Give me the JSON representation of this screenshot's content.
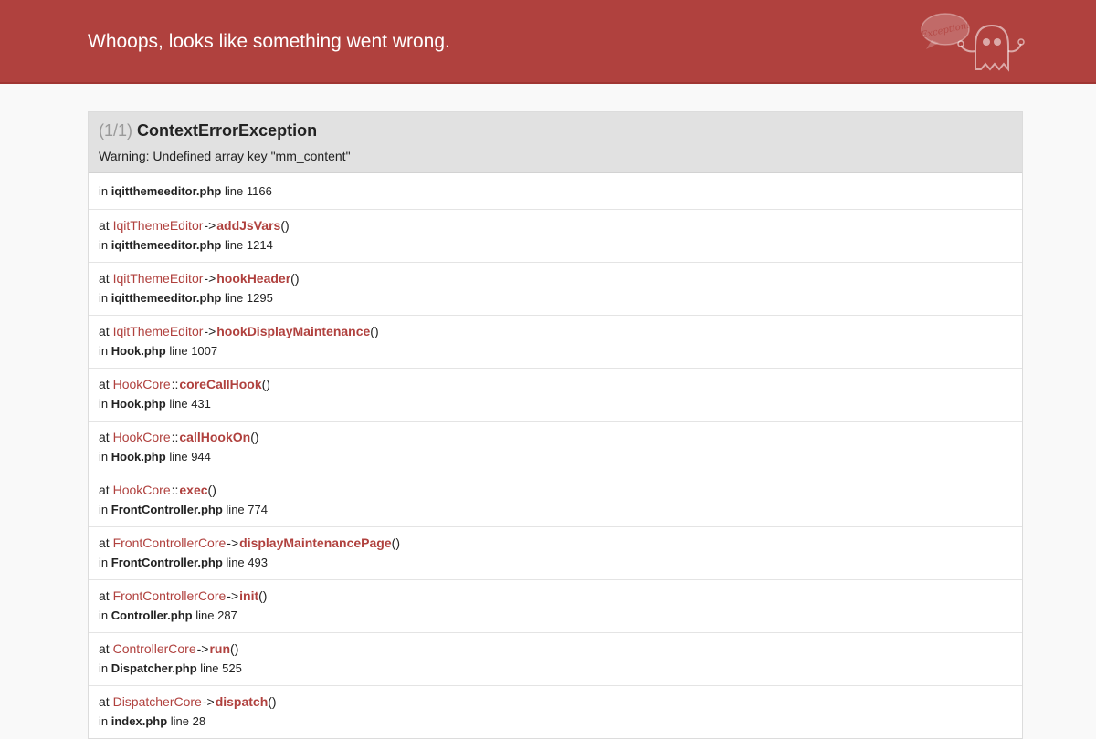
{
  "header": {
    "title": "Whoops, looks like something went wrong.",
    "logo_bubble": "Exception!"
  },
  "exception": {
    "count": "(1/1)",
    "name": "ContextErrorException",
    "message": "Warning: Undefined array key \"mm_content\""
  },
  "trace": [
    {
      "at": "",
      "cls": "",
      "op": "",
      "fn": "",
      "in": "in",
      "file": "iqitthemeeditor.php",
      "line_label": "line",
      "line": "1166"
    },
    {
      "at": "at",
      "cls": "IqitThemeEditor",
      "op": "->",
      "fn": "addJsVars",
      "parens": "()",
      "in": "in",
      "file": "iqitthemeeditor.php",
      "line_label": "line",
      "line": "1214"
    },
    {
      "at": "at",
      "cls": "IqitThemeEditor",
      "op": "->",
      "fn": "hookHeader",
      "parens": "()",
      "in": "in",
      "file": "iqitthemeeditor.php",
      "line_label": "line",
      "line": "1295"
    },
    {
      "at": "at",
      "cls": "IqitThemeEditor",
      "op": "->",
      "fn": "hookDisplayMaintenance",
      "parens": "()",
      "in": "in",
      "file": "Hook.php",
      "line_label": "line",
      "line": "1007"
    },
    {
      "at": "at",
      "cls": "HookCore",
      "op": "::",
      "fn": "coreCallHook",
      "parens": "()",
      "in": "in",
      "file": "Hook.php",
      "line_label": "line",
      "line": "431"
    },
    {
      "at": "at",
      "cls": "HookCore",
      "op": "::",
      "fn": "callHookOn",
      "parens": "()",
      "in": "in",
      "file": "Hook.php",
      "line_label": "line",
      "line": "944"
    },
    {
      "at": "at",
      "cls": "HookCore",
      "op": "::",
      "fn": "exec",
      "parens": "()",
      "in": "in",
      "file": "FrontController.php",
      "line_label": "line",
      "line": "774"
    },
    {
      "at": "at",
      "cls": "FrontControllerCore",
      "op": "->",
      "fn": "displayMaintenancePage",
      "parens": "()",
      "in": "in",
      "file": "FrontController.php",
      "line_label": "line",
      "line": "493"
    },
    {
      "at": "at",
      "cls": "FrontControllerCore",
      "op": "->",
      "fn": "init",
      "parens": "()",
      "in": "in",
      "file": "Controller.php",
      "line_label": "line",
      "line": "287"
    },
    {
      "at": "at",
      "cls": "ControllerCore",
      "op": "->",
      "fn": "run",
      "parens": "()",
      "in": "in",
      "file": "Dispatcher.php",
      "line_label": "line",
      "line": "525"
    },
    {
      "at": "at",
      "cls": "DispatcherCore",
      "op": "->",
      "fn": "dispatch",
      "parens": "()",
      "in": "in",
      "file": "index.php",
      "line_label": "line",
      "line": "28"
    }
  ],
  "colors": {
    "header_bg": "#b0413e",
    "accent": "#b0413e",
    "panel_head_bg": "#e1e1e1"
  }
}
